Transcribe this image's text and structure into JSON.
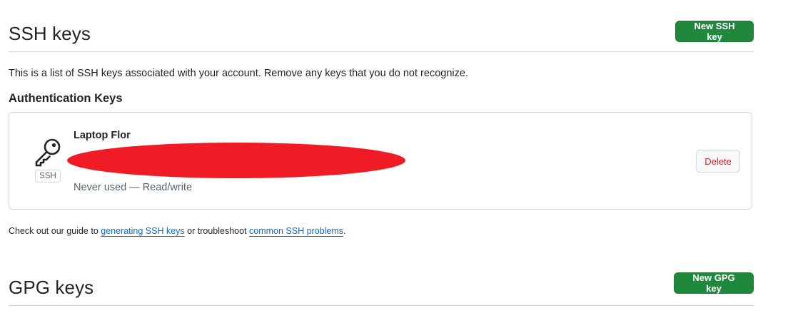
{
  "ssh_section": {
    "title": "SSH keys",
    "new_button_label": "New SSH key",
    "intro": "This is a list of SSH keys associated with your account. Remove any keys that you do not recognize.",
    "auth_heading": "Authentication Keys",
    "key": {
      "icon": "key-icon",
      "type_badge": "SSH",
      "title": "Laptop Flor",
      "usage": "Never used — Read/write",
      "delete_label": "Delete"
    },
    "help": {
      "prefix": "Check out our guide to ",
      "link1": "generating SSH keys",
      "middle": " or troubleshoot ",
      "link2": "common SSH problems",
      "suffix": "."
    }
  },
  "gpg_section": {
    "title": "GPG keys",
    "new_button_label": "New GPG key"
  },
  "colors": {
    "primary_button": "#1f883d",
    "danger_text": "#d1242f",
    "link": "#0969da",
    "redaction": "#ef1c25"
  }
}
